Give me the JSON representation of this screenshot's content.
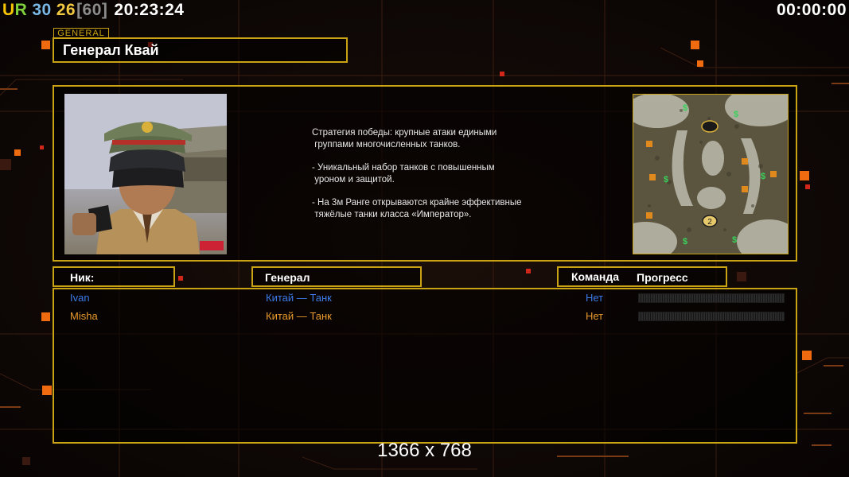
{
  "hud": {
    "ur_prefix": "U",
    "ur_suffix": "R",
    "num1": "30",
    "num2": "26",
    "num3": "[60]",
    "clock": "20:23:24",
    "game_timer": "00:00:00"
  },
  "general_tag": "GENERAL",
  "general_name": "Генерал Квай",
  "description": [
    "Стратегия победы: крупные атаки едиными\n группами многочисленных танков.",
    "- Уникальный набор танков с повышенным\n уроном и защитой.",
    "- На 3м Ранге открываются крайне эффективные\n тяжёлые танки класса «Император»."
  ],
  "map": {
    "start_positions": [
      "1",
      "2"
    ],
    "supply_marker": "$"
  },
  "headers": {
    "nick": "Ник:",
    "general": "Генерал",
    "team": "Команда",
    "progress": "Прогресс"
  },
  "players": [
    {
      "nick": "Ivan",
      "general": "Китай — Танк",
      "team": "Нет",
      "color": "#3c7be8",
      "progress": 0
    },
    {
      "nick": "Misha",
      "general": "Китай — Танк",
      "team": "Нет",
      "color": "#e99a2c",
      "progress": 0
    }
  ],
  "resolution": "1366 x 768",
  "colors": {
    "accent": "#c9a313",
    "player1": "#3c7be8",
    "player2": "#e99a2c"
  }
}
